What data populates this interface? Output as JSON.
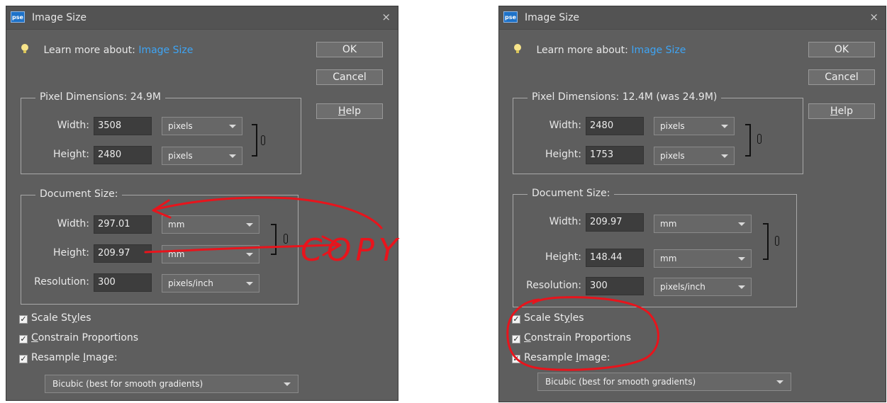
{
  "dialogs": [
    {
      "logo_text": "pse",
      "title": "Image Size",
      "close_glyph": "×",
      "learn_prefix": "Learn more about:",
      "learn_link": "Image Size",
      "buttons": {
        "ok": "OK",
        "cancel": "Cancel",
        "help_mnemonic": "H",
        "help_rest": "elp"
      },
      "pixel_dimensions": {
        "title": "Pixel Dimensions:  24.9M",
        "width_label": "Width:",
        "width_value": "3508",
        "width_unit": "pixels",
        "height_label": "Height:",
        "height_value": "2480",
        "height_unit": "pixels"
      },
      "document_size": {
        "title": "Document Size:",
        "width_label": "Width:",
        "width_value": "297.01",
        "width_unit": "mm",
        "height_label": "Height:",
        "height_value": "209.97",
        "height_unit": "mm",
        "resolution_label": "Resolution:",
        "resolution_value": "300",
        "resolution_unit": "pixels/inch"
      },
      "checkboxes": {
        "scale_styles": {
          "pre": "Scale St",
          "mn": "y",
          "post": "les",
          "checked": true
        },
        "constrain": {
          "pre": "",
          "mn": "C",
          "post": "onstrain Proportions",
          "checked": true
        },
        "resample": {
          "pre": "Resample ",
          "mn": "I",
          "post": "mage:",
          "checked": true
        }
      },
      "resample_method": "Bicubic (best for smooth gradients)"
    },
    {
      "logo_text": "pse",
      "title": "Image Size",
      "close_glyph": "×",
      "learn_prefix": "Learn more about:",
      "learn_link": "Image Size",
      "buttons": {
        "ok": "OK",
        "cancel": "Cancel",
        "help_mnemonic": "H",
        "help_rest": "elp"
      },
      "pixel_dimensions": {
        "title": "Pixel Dimensions:  12.4M (was 24.9M)",
        "width_label": "Width:",
        "width_value": "2480",
        "width_unit": "pixels",
        "height_label": "Height:",
        "height_value": "1753",
        "height_unit": "pixels"
      },
      "document_size": {
        "title": "Document Size:",
        "width_label": "Width:",
        "width_value": "209.97",
        "width_unit": "mm",
        "height_label": "Height:",
        "height_value": "148.44",
        "height_unit": "mm",
        "resolution_label": "Resolution:",
        "resolution_value": "300",
        "resolution_unit": "pixels/inch"
      },
      "checkboxes": {
        "scale_styles": {
          "pre": "Scale St",
          "mn": "y",
          "post": "les",
          "checked": true
        },
        "constrain": {
          "pre": "",
          "mn": "C",
          "post": "onstrain Proportions",
          "checked": true
        },
        "resample": {
          "pre": "Resample ",
          "mn": "I",
          "post": "mage:",
          "checked": true
        }
      },
      "resample_method": "Bicubic (best for smooth gradients)"
    }
  ],
  "annotations": {
    "copy_text": "COPY",
    "ink_color": "#e8141c"
  },
  "colors": {
    "dialog_bg": "#5e5e5e",
    "link": "#3ea4f4",
    "field_bg": "#3d3d3d"
  }
}
